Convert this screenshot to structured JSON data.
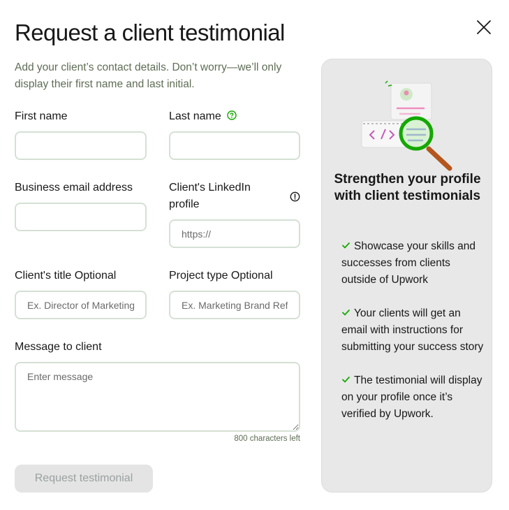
{
  "modal": {
    "title": "Request a client testimonial",
    "subtitle": "Add your client’s contact details. Don’t worry—we’ll only display their first name and last initial."
  },
  "form": {
    "first_name": {
      "label": "First name",
      "value": "",
      "placeholder": ""
    },
    "last_name": {
      "label": "Last name",
      "value": "",
      "placeholder": ""
    },
    "business_email": {
      "label": "Business email address",
      "value": "",
      "placeholder": ""
    },
    "linkedin": {
      "label": "Client's LinkedIn profile",
      "value": "",
      "placeholder": "https://"
    },
    "client_title": {
      "label": "Client's title Optional",
      "value": "",
      "placeholder": "Ex. Director of Marketing"
    },
    "project_type": {
      "label": "Project type Optional",
      "value": "",
      "placeholder": "Ex. Marketing Brand Refresh"
    },
    "message": {
      "label": "Message to client",
      "value": "",
      "placeholder": "Enter message",
      "chars_left": "800 characters left"
    },
    "submit_label": "Request testimonial"
  },
  "panel": {
    "title": "Strengthen your profile with client testimonials",
    "bullets": [
      "Showcase your skills and successes from clients outside of Upwork",
      "Your clients will get an email with instructions for submitting your success story",
      "The testimonial will display on your profile once it’s verified by Upwork."
    ]
  },
  "icons": {
    "close": "close-icon",
    "help": "question-circle-icon",
    "info": "info-circle-icon",
    "check": "check-icon",
    "illustration": "magnifier-profile-illustration"
  },
  "colors": {
    "brand_green": "#14a800",
    "text": "#181818",
    "muted": "#5e6d55",
    "panel_bg": "#e8e8e8",
    "disabled_btn": "#e4e4e4"
  }
}
